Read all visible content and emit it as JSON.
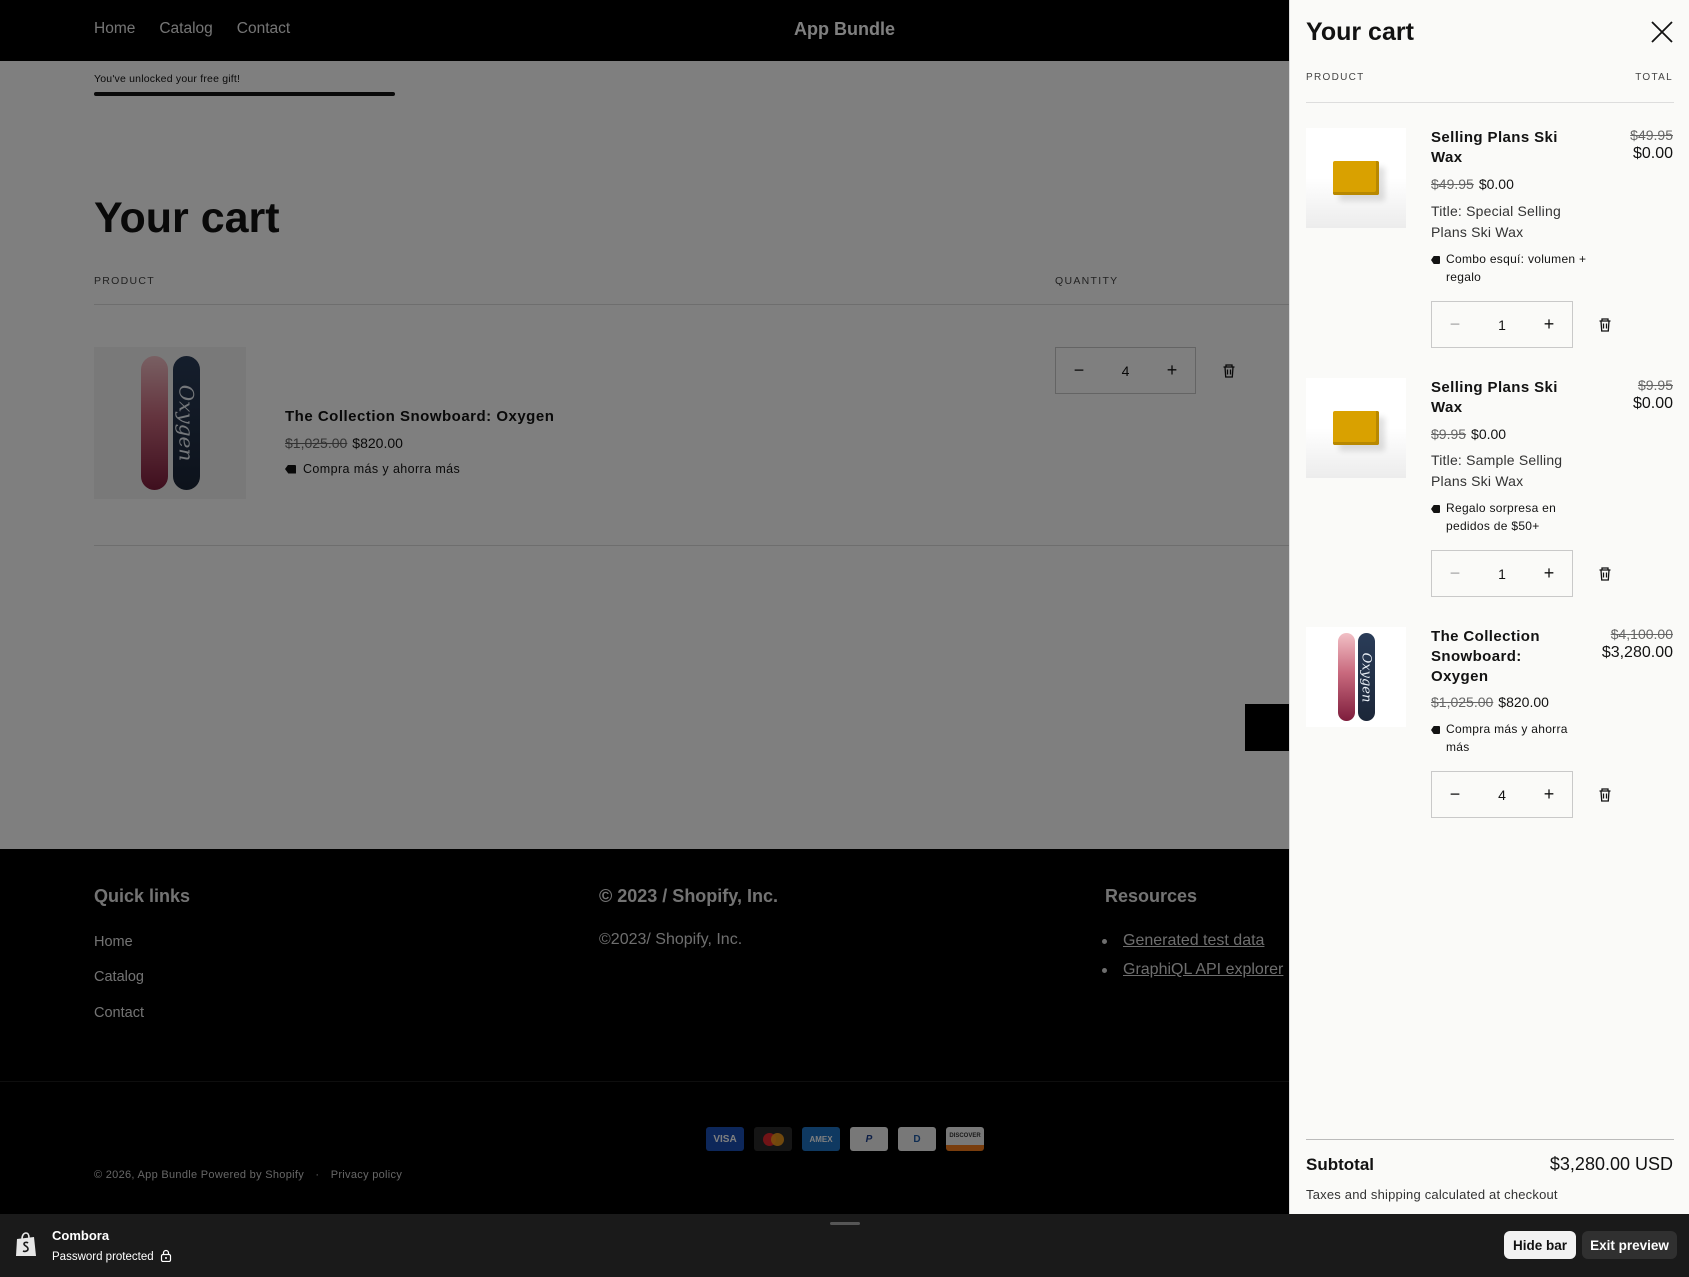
{
  "header": {
    "nav": [
      "Home",
      "Catalog",
      "Contact"
    ],
    "brand": "App Bundle"
  },
  "main": {
    "gift_text": "You've unlocked your free gift!",
    "gift_progress": 1.0,
    "title": "Your cart",
    "col_product": "PRODUCT",
    "col_quantity": "QUANTITY",
    "item": {
      "name": "The Collection Snowboard: Oxygen",
      "old_price": "$1,025.00",
      "price": "$820.00",
      "discount": "Compra más y ahorra más",
      "quantity": "4",
      "board_text": "Oxygen"
    }
  },
  "footer": {
    "quick_links_title": "Quick links",
    "quick_links": [
      "Home",
      "Catalog",
      "Contact"
    ],
    "copyright_title": "© 2023 / Shopify, Inc.",
    "copyright_text": "©2023/ Shopify, Inc.",
    "resources_title": "Resources",
    "resources": [
      "Generated test data",
      "GraphiQL API explorer"
    ],
    "payments": [
      "VISA",
      "MC",
      "AMEX",
      "P",
      "D",
      "DISCOVER"
    ],
    "bottom_copy": "© 2026, App Bundle",
    "powered": "Powered by Shopify",
    "separator": "·",
    "privacy": "Privacy policy"
  },
  "drawer": {
    "title": "Your cart",
    "col_product": "PRODUCT",
    "col_total": "TOTAL",
    "items": [
      {
        "name": "Selling Plans Ski Wax",
        "old_price": "$49.95",
        "price": "$0.00",
        "variant": "Title: Special Selling Plans Ski Wax",
        "discount": "Combo esquí: volumen + regalo",
        "quantity": "1",
        "total_old": "$49.95",
        "total": "$0.00"
      },
      {
        "name": "Selling Plans Ski Wax",
        "old_price": "$9.95",
        "price": "$0.00",
        "variant": "Title: Sample Selling Plans Ski Wax",
        "discount": "Regalo sorpresa en pedidos de $50+",
        "quantity": "1",
        "total_old": "$9.95",
        "total": "$0.00"
      },
      {
        "name": "The Collection Snowboard: Oxygen",
        "old_price": "$1,025.00",
        "price": "$820.00",
        "discount": "Compra más y ahorra más",
        "quantity": "4",
        "total_old": "$4,100.00",
        "total": "$3,280.00"
      }
    ],
    "subtotal_label": "Subtotal",
    "subtotal_value": "$3,280.00 USD",
    "tax_note": "Taxes and shipping calculated at checkout"
  },
  "preview_bar": {
    "store": "Combora",
    "status": "Password protected",
    "hide_label": "Hide bar",
    "exit_label": "Exit preview"
  },
  "colors": {
    "header_bg": "#000000",
    "drawer_bg": "#fafaf8",
    "overlay": "rgba(0,0,0,0.5)",
    "wax": "#d9a100"
  }
}
